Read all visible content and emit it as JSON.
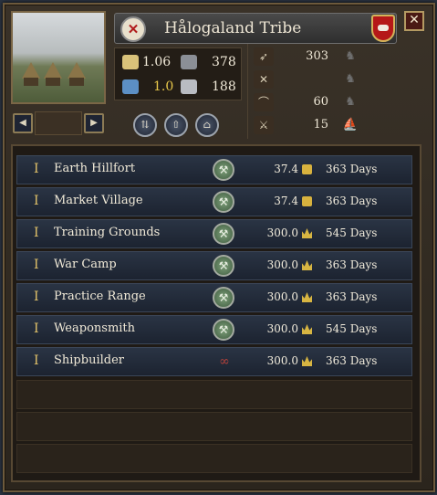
{
  "header": {
    "title": "Hålogaland Tribe",
    "crest_icon": "crossed-axes-icon",
    "close_label": "✕"
  },
  "stats": {
    "gold": "1.06",
    "garrison": "378",
    "fort_level": "1.0",
    "fort_value": "188"
  },
  "levies": [
    {
      "value": "303"
    },
    {
      "value": ""
    },
    {
      "value": "60"
    },
    {
      "value": "15"
    }
  ],
  "buildings": [
    {
      "tier": "I",
      "name": "Earth Hillfort",
      "status": "build",
      "cost": "37.4",
      "currency": "money",
      "days": "363 Days"
    },
    {
      "tier": "I",
      "name": "Market Village",
      "status": "build",
      "cost": "37.4",
      "currency": "money",
      "days": "363 Days"
    },
    {
      "tier": "I",
      "name": "Training Grounds",
      "status": "build",
      "cost": "300.0",
      "currency": "prestige",
      "days": "545 Days"
    },
    {
      "tier": "I",
      "name": "War Camp",
      "status": "build",
      "cost": "300.0",
      "currency": "prestige",
      "days": "363 Days"
    },
    {
      "tier": "I",
      "name": "Practice Range",
      "status": "build",
      "cost": "300.0",
      "currency": "prestige",
      "days": "363 Days"
    },
    {
      "tier": "I",
      "name": "Weaponsmith",
      "status": "build",
      "cost": "300.0",
      "currency": "prestige",
      "days": "545 Days"
    },
    {
      "tier": "I",
      "name": "Shipbuilder",
      "status": "locked",
      "cost": "300.0",
      "currency": "prestige",
      "days": "363 Days"
    }
  ],
  "colors": {
    "accent_gold": "#e8c84a",
    "row_bg": "#1c2330",
    "frame": "#574833"
  }
}
